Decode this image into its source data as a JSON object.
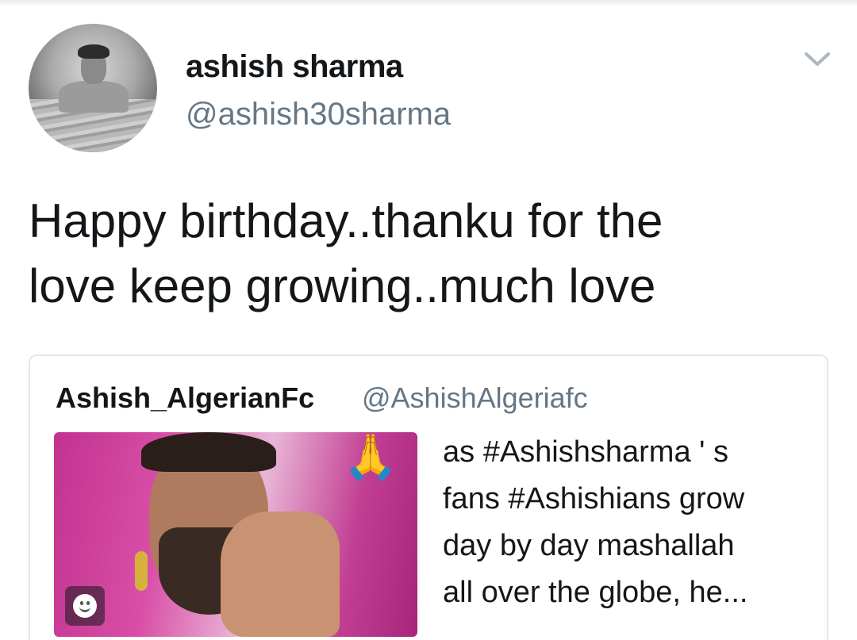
{
  "tweet": {
    "author": {
      "display_name": "ashish sharma",
      "handle": "@ashish30sharma"
    },
    "menu_icon": "chevron-down-icon",
    "text_lines": [
      "Happy birthday..thanku for the",
      "love keep growing..much love"
    ]
  },
  "quoted_tweet": {
    "author": {
      "display_name": "Ashish_AlgerianFc",
      "handle": "@AshishAlgeriafc"
    },
    "media": {
      "overlay_emoji": "🙏",
      "badge_icon": "smiley-icon"
    },
    "text_lines": [
      "as #Ashishsharma ' s",
      "fans #Ashishians grow",
      "day by day mashallah",
      "all over the globe,  he..."
    ]
  },
  "colors": {
    "primary_text": "#14171a",
    "secondary_text": "#657786",
    "border": "#e1e8ed"
  }
}
